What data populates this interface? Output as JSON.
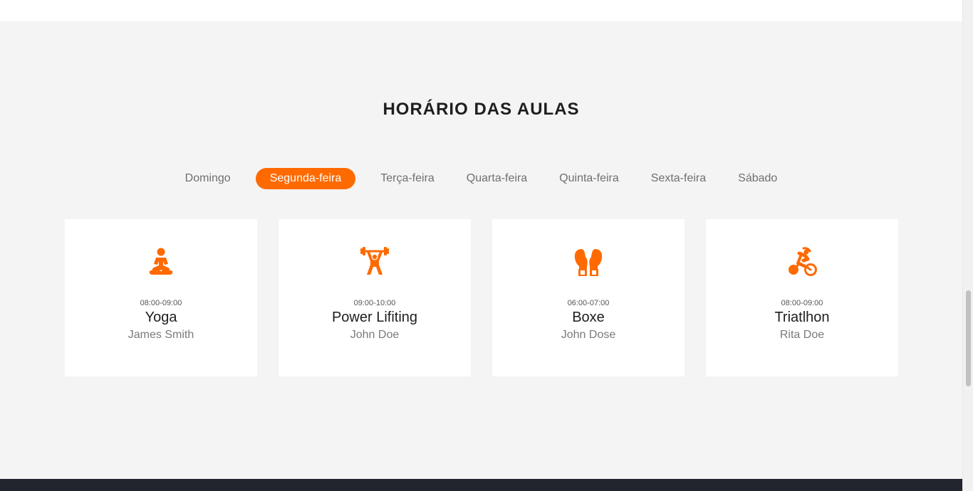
{
  "section": {
    "title": "HORÁRIO DAS AULAS"
  },
  "tabs": [
    {
      "label": "Domingo",
      "active": false
    },
    {
      "label": "Segunda-feira",
      "active": true
    },
    {
      "label": "Terça-feira",
      "active": false
    },
    {
      "label": "Quarta-feira",
      "active": false
    },
    {
      "label": "Quinta-feira",
      "active": false
    },
    {
      "label": "Sexta-feira",
      "active": false
    },
    {
      "label": "Sábado",
      "active": false
    }
  ],
  "classes": [
    {
      "icon": "yoga-icon",
      "time": "08:00-09:00",
      "name": "Yoga",
      "trainer": "James Smith"
    },
    {
      "icon": "weightlifting-icon",
      "time": "09:00-10:00",
      "name": "Power Lifiting",
      "trainer": "John Doe"
    },
    {
      "icon": "boxing-gloves-icon",
      "time": "06:00-07:00",
      "name": "Boxe",
      "trainer": "John Dose"
    },
    {
      "icon": "cycling-icon",
      "time": "08:00-09:00",
      "name": "Triatlhon",
      "trainer": "Rita Doe"
    }
  ],
  "colors": {
    "accent": "#ff6a00",
    "background": "#f4f4f4",
    "footer": "#22252e"
  }
}
